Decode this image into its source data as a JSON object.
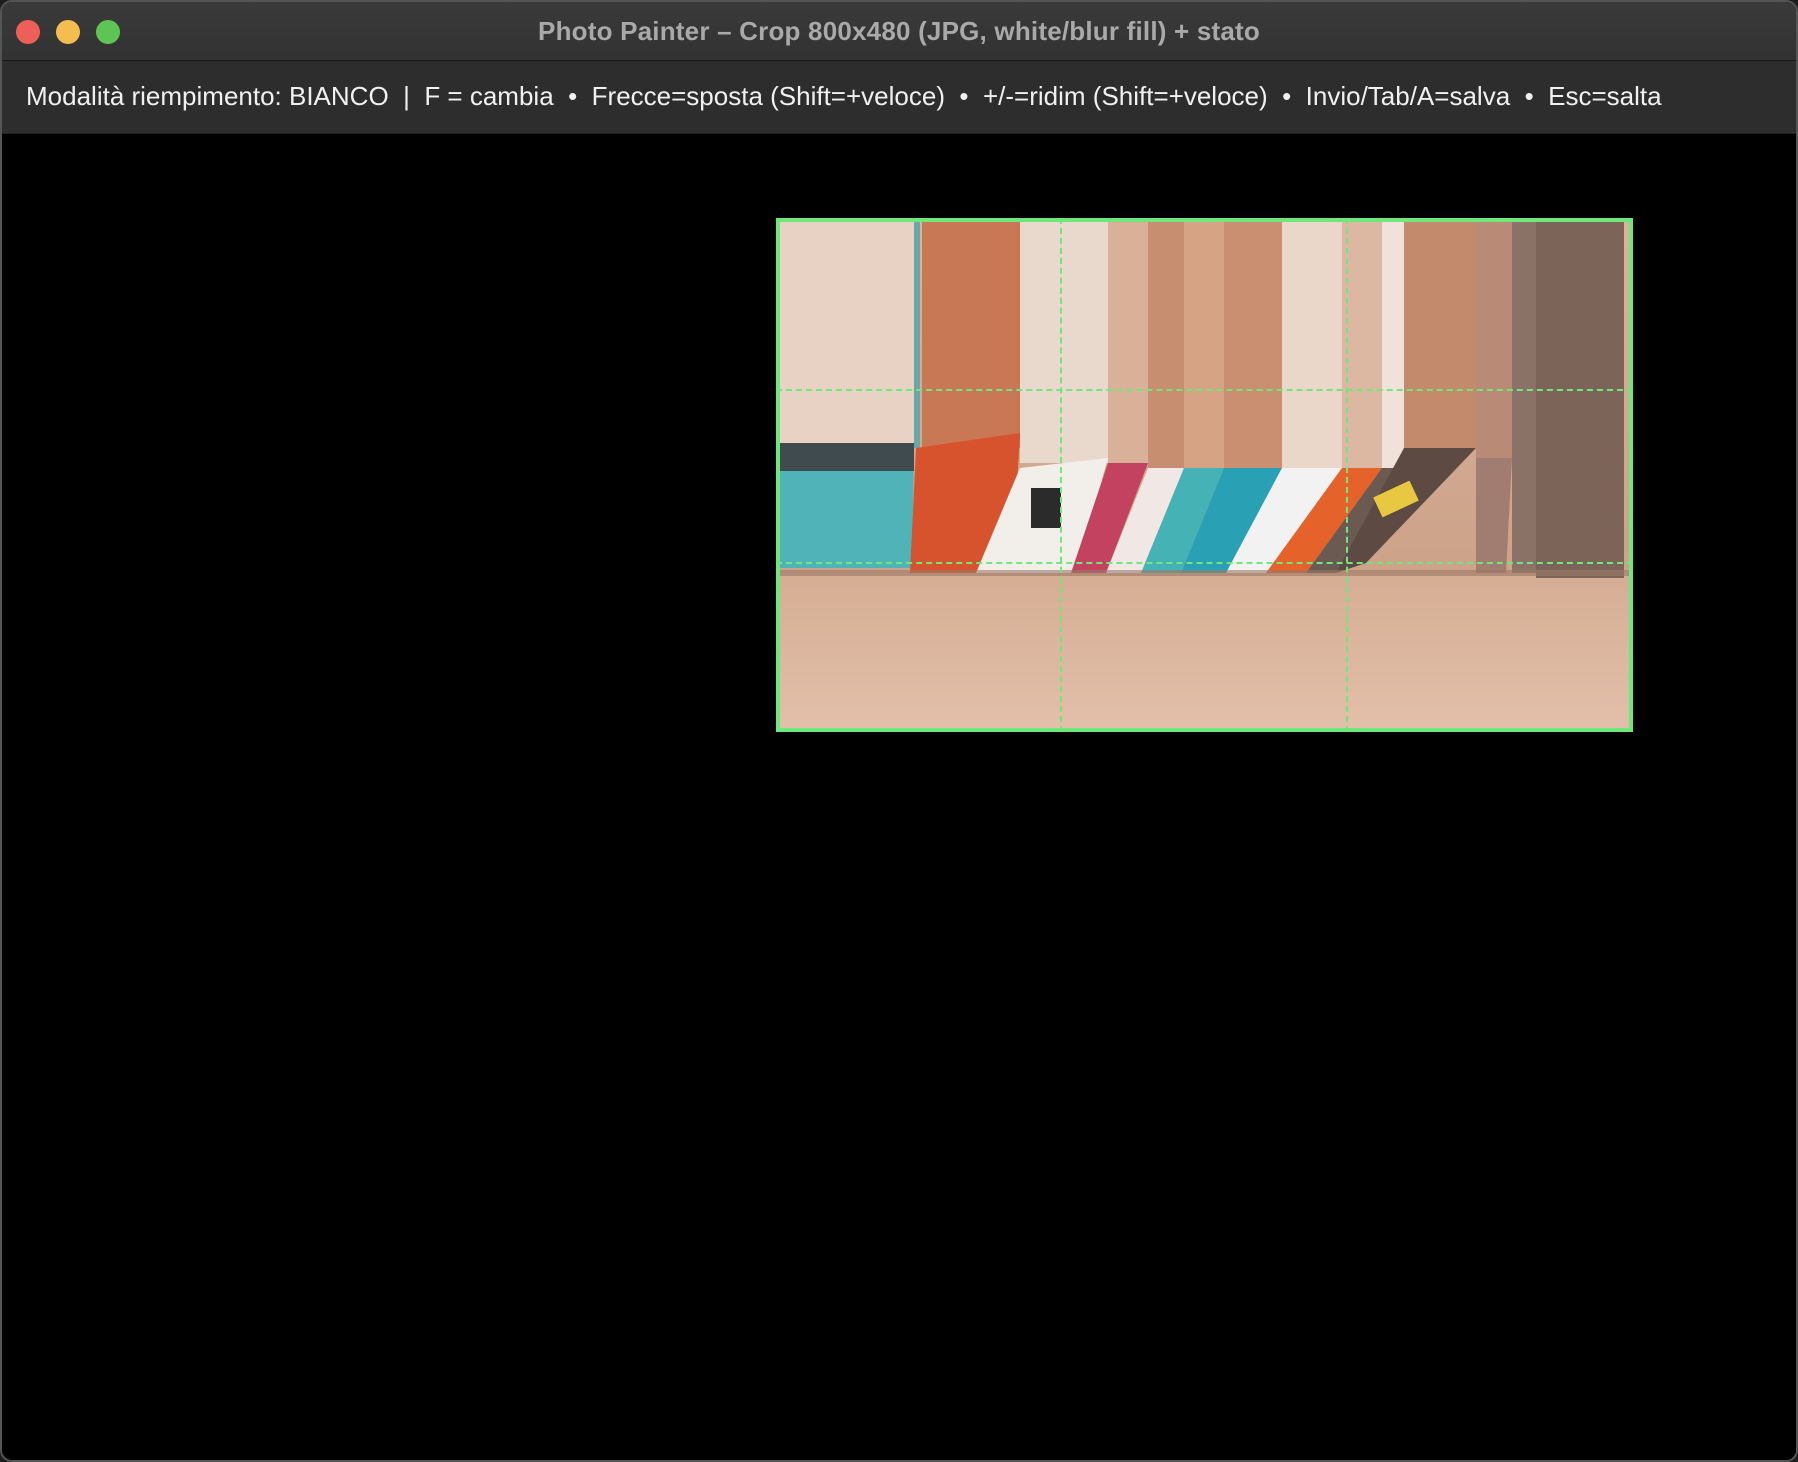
{
  "window": {
    "title": "Photo Painter – Crop 800x480 (JPG, white/blur fill) + stato"
  },
  "status": {
    "text": "Modalità riempimento: BIANCO  |  F = cambia  •  Frecce=sposta (Shift=+veloce)  •  +/-=ridim (Shift=+veloce)  •  Invio/Tab/A=salva  •  Esc=salta"
  },
  "colors": {
    "crop_frame": "#6ee87c",
    "canvas_bg": "#000000",
    "close": "#ee5f57",
    "minimize": "#f4bd4f",
    "maximize": "#5ec454"
  },
  "icons": {
    "close": "close-dot-icon",
    "minimize": "minimize-dot-icon",
    "maximize": "maximize-dot-icon"
  }
}
